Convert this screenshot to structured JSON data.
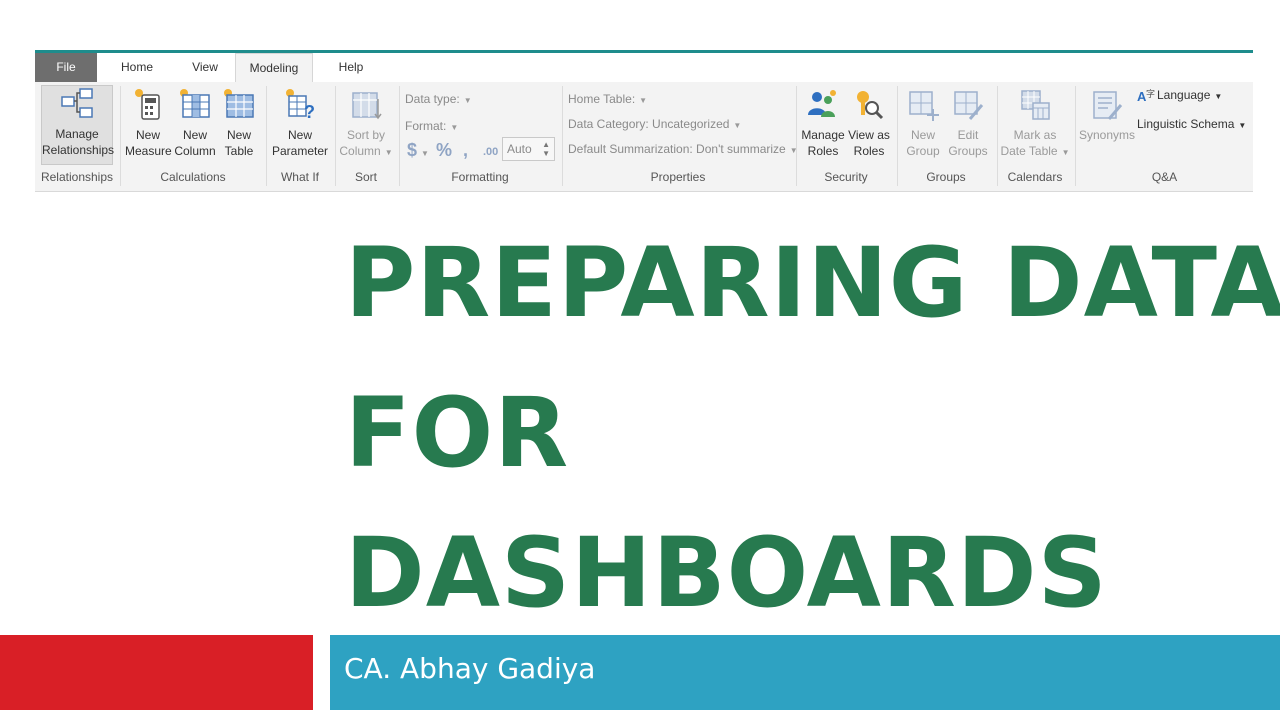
{
  "ribbon": {
    "tabs": [
      "File",
      "Home",
      "View",
      "Modeling",
      "Help"
    ],
    "relationships": {
      "manage_line1": "Manage",
      "manage_line2": "Relationships",
      "group": "Relationships"
    },
    "calculations": {
      "new_measure": [
        "New",
        "Measure"
      ],
      "new_column": [
        "New",
        "Column"
      ],
      "new_table": [
        "New",
        "Table"
      ],
      "group": "Calculations"
    },
    "whatif": {
      "new_parameter": [
        "New",
        "Parameter"
      ],
      "group": "What If"
    },
    "sort": {
      "sort_by_column": [
        "Sort by",
        "Column"
      ],
      "group": "Sort"
    },
    "formatting": {
      "data_type": "Data type:",
      "format": "Format:",
      "currency": "$",
      "percent": "%",
      "comma": ",",
      "decimals": ".00",
      "auto": "Auto",
      "group": "Formatting"
    },
    "properties": {
      "home_table": "Home Table:",
      "data_category": "Data Category: Uncategorized",
      "default_summarization": "Default Summarization: Don't summarize",
      "group": "Properties"
    },
    "security": {
      "manage_roles": [
        "Manage",
        "Roles"
      ],
      "view_as_roles": [
        "View as",
        "Roles"
      ],
      "group": "Security"
    },
    "groups": {
      "new_group": [
        "New",
        "Group"
      ],
      "edit_groups": [
        "Edit",
        "Groups"
      ],
      "group": "Groups"
    },
    "calendars": {
      "mark_as_date_table": [
        "Mark as",
        "Date Table"
      ],
      "group": "Calendars"
    },
    "qa": {
      "synonyms": "Synonyms",
      "language": "Language",
      "linguistic_schema": "Linguistic Schema",
      "group": "Q&A"
    }
  },
  "title": {
    "line1": "PREPARING DATA",
    "line2": "FOR",
    "line3": "DASHBOARDS"
  },
  "author": "CA. Abhay Gadiya",
  "colors": {
    "title": "#277a4f",
    "red_bar": "#d91f26",
    "teal_bar": "#2ea2c2",
    "ribbon_accent": "#1e8c8c"
  }
}
